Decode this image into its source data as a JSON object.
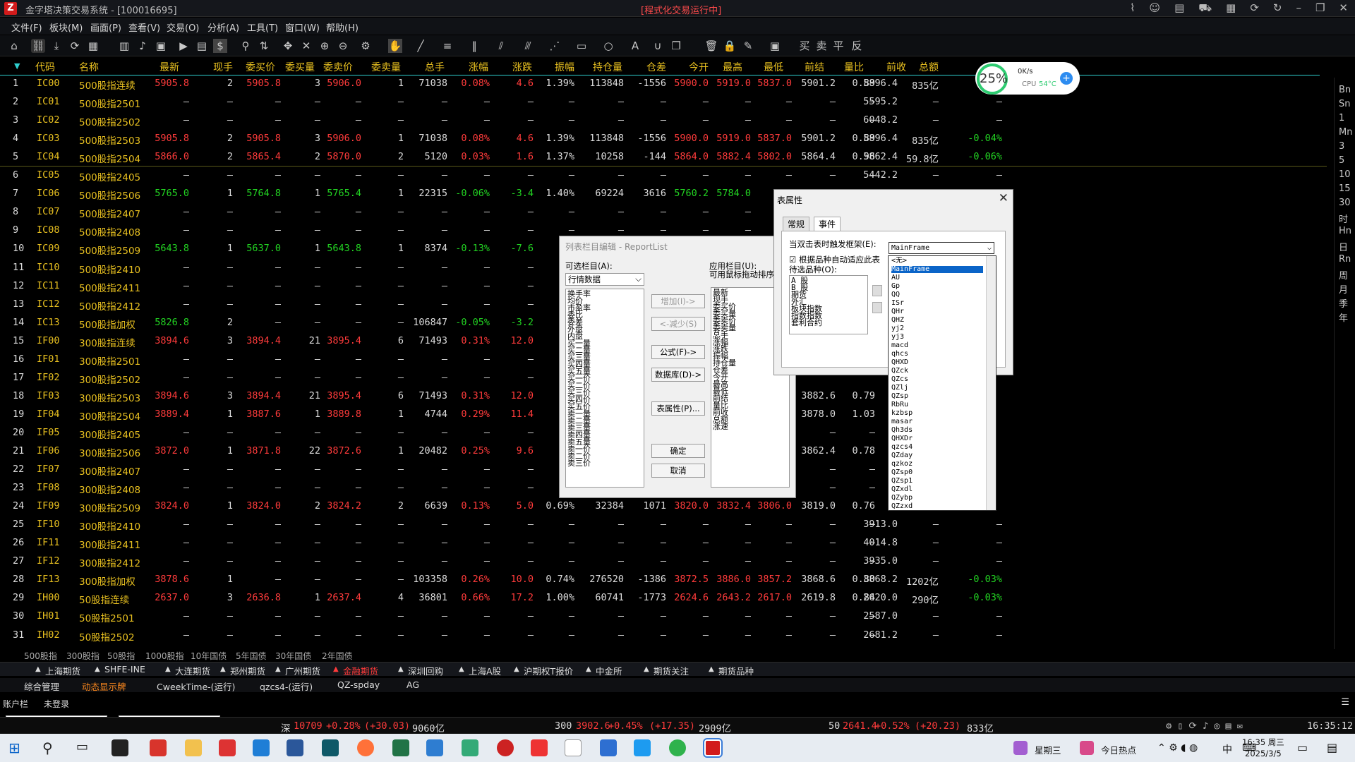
{
  "app": {
    "title": "金字塔决策交易系统 - [100016695]",
    "center_status": "[程式化交易运行中]"
  },
  "menu": [
    "文件(F)",
    "板块(M)",
    "画面(P)",
    "查看(V)",
    "交易(O)",
    "分析(A)",
    "工具(T)",
    "窗口(W)",
    "帮助(H)"
  ],
  "columns": [
    "代码",
    "名称",
    "最新",
    "现手",
    "委买价",
    "委买量",
    "委卖价",
    "委卖量",
    "总手",
    "涨幅",
    "涨跌",
    "振幅",
    "持仓量",
    "仓差",
    "今开",
    "最高",
    "最低",
    "前结",
    "量比",
    "前收",
    "总额"
  ],
  "colors": {
    "header": "#e8c020",
    "up": "#ff3b3b",
    "down": "#22d322",
    "neutral": "#dddddd",
    "code": "#e8c020",
    "name": "#e8c020"
  },
  "rows": [
    [
      "1",
      "IC00",
      "500股指连续",
      "5905.8",
      "2",
      "5905.8",
      "3",
      "5906.0",
      "1",
      "71038",
      "0.08%",
      "4.6",
      "1.39%",
      "113848",
      "-1556",
      "5900.0",
      "5919.0",
      "5837.0",
      "5901.2",
      "0.89",
      "5896.4",
      "835亿",
      ""
    ],
    [
      "2",
      "IC01",
      "500股指2501",
      "—",
      "—",
      "—",
      "—",
      "—",
      "—",
      "—",
      "—",
      "—",
      "—",
      "—",
      "—",
      "—",
      "—",
      "—",
      "—",
      "—",
      "5595.2",
      "—",
      "—"
    ],
    [
      "3",
      "IC02",
      "500股指2502",
      "—",
      "—",
      "—",
      "—",
      "—",
      "—",
      "—",
      "—",
      "—",
      "—",
      "—",
      "—",
      "—",
      "—",
      "—",
      "—",
      "—",
      "6048.2",
      "—",
      "—"
    ],
    [
      "4",
      "IC03",
      "500股指2503",
      "5905.8",
      "2",
      "5905.8",
      "3",
      "5906.0",
      "1",
      "71038",
      "0.08%",
      "4.6",
      "1.39%",
      "113848",
      "-1556",
      "5900.0",
      "5919.0",
      "5837.0",
      "5901.2",
      "0.89",
      "5896.4",
      "835亿",
      "-0.04%"
    ],
    [
      "5",
      "IC04",
      "500股指2504",
      "5866.0",
      "2",
      "5865.4",
      "2",
      "5870.0",
      "2",
      "5120",
      "0.03%",
      "1.6",
      "1.37%",
      "10258",
      "-144",
      "5864.0",
      "5882.4",
      "5802.0",
      "5864.4",
      "0.96",
      "5862.4",
      "59.8亿",
      "-0.06%"
    ],
    [
      "6",
      "IC05",
      "500股指2405",
      "—",
      "—",
      "—",
      "—",
      "—",
      "—",
      "—",
      "—",
      "—",
      "—",
      "—",
      "—",
      "—",
      "—",
      "—",
      "—",
      "—",
      "5442.2",
      "—",
      "—"
    ],
    [
      "7",
      "IC06",
      "500股指2506",
      "5765.0",
      "1",
      "5764.8",
      "1",
      "5765.4",
      "1",
      "22315",
      "-0.06%",
      "-3.4",
      "1.40%",
      "69224",
      "3616",
      "5760.2",
      "5784.0",
      "57",
      "",
      "",
      "",
      "",
      ""
    ],
    [
      "8",
      "IC07",
      "500股指2407",
      "—",
      "—",
      "—",
      "—",
      "—",
      "—",
      "—",
      "—",
      "—",
      "—",
      "—",
      "—",
      "—",
      "—",
      "",
      "",
      "",
      "",
      "",
      ""
    ],
    [
      "9",
      "IC08",
      "500股指2408",
      "—",
      "—",
      "—",
      "—",
      "—",
      "—",
      "—",
      "—",
      "—",
      "—",
      "—",
      "—",
      "—",
      "—",
      "",
      "",
      "",
      "",
      "",
      ""
    ],
    [
      "10",
      "IC09",
      "500股指2509",
      "5643.8",
      "1",
      "5637.0",
      "1",
      "5643.8",
      "1",
      "8374",
      "-0.13%",
      "-7.6",
      "1.",
      "",
      "",
      "",
      "",
      "",
      "",
      "",
      "",
      "",
      ""
    ],
    [
      "11",
      "IC10",
      "500股指2410",
      "—",
      "—",
      "—",
      "—",
      "—",
      "—",
      "—",
      "—",
      "—",
      "",
      "",
      "",
      "",
      "",
      "",
      "",
      "",
      "",
      "",
      ""
    ],
    [
      "12",
      "IC11",
      "500股指2411",
      "—",
      "—",
      "—",
      "—",
      "—",
      "—",
      "—",
      "—",
      "—",
      "",
      "",
      "",
      "",
      "",
      "",
      "",
      "",
      "",
      "",
      ""
    ],
    [
      "13",
      "IC12",
      "500股指2412",
      "—",
      "—",
      "—",
      "—",
      "—",
      "—",
      "—",
      "—",
      "—",
      "",
      "",
      "",
      "",
      "",
      "",
      "",
      "",
      "",
      "",
      ""
    ],
    [
      "14",
      "IC13",
      "500股指加权",
      "5826.8",
      "2",
      "—",
      "—",
      "—",
      "—",
      "106847",
      "-0.05%",
      "-3.2",
      "1.",
      "",
      "",
      "",
      "",
      "",
      "",
      "",
      "",
      "",
      ""
    ],
    [
      "15",
      "IF00",
      "300股指连续",
      "3894.6",
      "3",
      "3894.4",
      "21",
      "3895.4",
      "6",
      "71493",
      "0.31%",
      "12.0",
      "0.",
      "",
      "",
      "",
      "",
      "",
      "",
      "",
      "",
      "",
      ""
    ],
    [
      "16",
      "IF01",
      "300股指2501",
      "—",
      "—",
      "—",
      "—",
      "—",
      "—",
      "—",
      "—",
      "—",
      "",
      "",
      "",
      "",
      "",
      "",
      "",
      "",
      "",
      "",
      ""
    ],
    [
      "17",
      "IF02",
      "300股指2502",
      "—",
      "—",
      "—",
      "—",
      "—",
      "—",
      "—",
      "—",
      "—",
      "",
      "",
      "",
      "",
      "",
      "",
      "",
      "",
      "",
      "",
      ""
    ],
    [
      "18",
      "IF03",
      "300股指2503",
      "3894.6",
      "3",
      "3894.4",
      "21",
      "3895.4",
      "6",
      "71493",
      "0.31%",
      "12.0",
      "0.",
      "",
      "",
      "",
      "",
      "",
      "3882.6",
      "0.79",
      "",
      "",
      ""
    ],
    [
      "19",
      "IF04",
      "300股指2504",
      "3889.4",
      "1",
      "3887.6",
      "1",
      "3889.8",
      "1",
      "4744",
      "0.29%",
      "11.4",
      "0.",
      "",
      "",
      "",
      "",
      "",
      "3878.0",
      "1.03",
      "",
      "",
      ""
    ],
    [
      "20",
      "IF05",
      "300股指2405",
      "—",
      "—",
      "—",
      "—",
      "—",
      "—",
      "—",
      "—",
      "—",
      "",
      "",
      "",
      "",
      "",
      "",
      "—",
      "—",
      "",
      "",
      ""
    ],
    [
      "21",
      "IF06",
      "300股指2506",
      "3872.0",
      "1",
      "3871.8",
      "22",
      "3872.6",
      "1",
      "20482",
      "0.25%",
      "9.6",
      "0.",
      "",
      "",
      "",
      "",
      "",
      "3862.4",
      "0.78",
      "",
      "",
      ""
    ],
    [
      "22",
      "IF07",
      "300股指2407",
      "—",
      "—",
      "—",
      "—",
      "—",
      "—",
      "—",
      "—",
      "—",
      "",
      "",
      "",
      "",
      "",
      "",
      "—",
      "—",
      "",
      "",
      ""
    ],
    [
      "23",
      "IF08",
      "300股指2408",
      "—",
      "—",
      "—",
      "—",
      "—",
      "—",
      "—",
      "—",
      "—",
      "",
      "",
      "",
      "",
      "",
      "",
      "—",
      "—",
      "",
      "",
      ""
    ],
    [
      "24",
      "IF09",
      "300股指2509",
      "3824.0",
      "1",
      "3824.0",
      "2",
      "3824.2",
      "2",
      "6639",
      "0.13%",
      "5.0",
      "0.69%",
      "32384",
      "1071",
      "3820.0",
      "3832.4",
      "3806.0",
      "3819.0",
      "0.76",
      "",
      "",
      ""
    ],
    [
      "25",
      "IF10",
      "300股指2410",
      "—",
      "—",
      "—",
      "—",
      "—",
      "—",
      "—",
      "—",
      "—",
      "—",
      "—",
      "—",
      "—",
      "—",
      "—",
      "—",
      "—",
      "3913.0",
      "—",
      "—"
    ],
    [
      "26",
      "IF11",
      "300股指2411",
      "—",
      "—",
      "—",
      "—",
      "—",
      "—",
      "—",
      "—",
      "—",
      "—",
      "—",
      "—",
      "—",
      "—",
      "—",
      "—",
      "—",
      "4014.8",
      "—",
      "—"
    ],
    [
      "27",
      "IF12",
      "300股指2412",
      "—",
      "—",
      "—",
      "—",
      "—",
      "—",
      "—",
      "—",
      "—",
      "—",
      "—",
      "—",
      "—",
      "—",
      "—",
      "—",
      "—",
      "3935.0",
      "—",
      "—"
    ],
    [
      "28",
      "IF13",
      "300股指加权",
      "3878.6",
      "1",
      "—",
      "—",
      "—",
      "—",
      "103358",
      "0.26%",
      "10.0",
      "0.74%",
      "276520",
      "-1386",
      "3872.5",
      "3886.0",
      "3857.2",
      "3868.6",
      "0.80",
      "3868.2",
      "1202亿",
      "-0.03%"
    ],
    [
      "29",
      "IH00",
      "50股指连续",
      "2637.0",
      "3",
      "2636.8",
      "1",
      "2637.4",
      "4",
      "36801",
      "0.66%",
      "17.2",
      "1.00%",
      "60741",
      "-1773",
      "2624.6",
      "2643.2",
      "2617.0",
      "2619.8",
      "0.84",
      "2620.0",
      "290亿",
      "-0.03%"
    ],
    [
      "30",
      "IH01",
      "50股指2501",
      "—",
      "—",
      "—",
      "—",
      "—",
      "—",
      "—",
      "—",
      "—",
      "—",
      "—",
      "—",
      "—",
      "—",
      "—",
      "—",
      "—",
      "2587.0",
      "—",
      "—"
    ],
    [
      "31",
      "IH02",
      "50股指2502",
      "—",
      "—",
      "—",
      "—",
      "—",
      "—",
      "—",
      "—",
      "—",
      "—",
      "—",
      "—",
      "—",
      "—",
      "—",
      "—",
      "—",
      "2681.2",
      "—",
      "—"
    ]
  ],
  "rightbar": [
    "Bn",
    "Sn",
    "1",
    "Mn",
    "3",
    "5",
    "10",
    "15",
    "30",
    "时",
    "Hn",
    "日",
    "Rn",
    "周",
    "月",
    "季",
    "年"
  ],
  "cpu": {
    "percent": "25%",
    "speed": "0K/s",
    "cpu_label": "CPU",
    "temp": "54°C"
  },
  "dialog_report": {
    "title": "列表栏目编辑 - ReportList",
    "avail_label": "可选栏目(A):",
    "avail_select": "行情数据",
    "applied_label": "应用栏目(U):",
    "applied_hint": "可用鼠标拖动排序",
    "add": "增加(I)->",
    "remove": "<-减少(S)",
    "formula": "公式(F)->",
    "database": "数据库(D)->",
    "props": "表属性(P)...",
    "ok": "确定",
    "cancel": "取消",
    "avail_items": [
      "换手率",
      "均价",
      "市盈率",
      "委比",
      "委差",
      "外盘",
      "内盘",
      "买一量",
      "买二量",
      "买三量",
      "买四量",
      "买五量",
      "买一价",
      "买二价",
      "买三价",
      "买四价",
      "买五价",
      "卖一量",
      "卖二量",
      "卖三量",
      "卖四量",
      "卖五量",
      "卖一价",
      "卖二价",
      "卖三价"
    ],
    "applied_items": [
      "最新",
      "现手",
      "委买价",
      "委买量",
      "委卖价",
      "委卖量",
      "总手",
      "涨幅",
      "涨跌",
      "振幅",
      "持仓量",
      "仓差",
      "今开",
      "最高",
      "最低",
      "前结",
      "量比",
      "前收",
      "总额",
      "涨速"
    ]
  },
  "dialog_props": {
    "title": "表属性",
    "tab_general": "常规",
    "tab_event": "事件",
    "trigger_label": "当双击表时触发框架(E):",
    "trigger_value": "MainFrame",
    "checkbox_label": "根据品种自动适应此表",
    "pending_label": "待选品种(O):",
    "pending_items": [
      "A 股",
      "B 股",
      "期货",
      "外汇",
      "板块指数",
      "指数指数",
      "套利合约"
    ]
  },
  "droplist": [
    "<无>",
    "MainFrame",
    "AU",
    "Gp",
    "QQ",
    "ISr",
    "QHr",
    "QHZ",
    "yj2",
    "yj3",
    "macd",
    "qhcs",
    "QHXD",
    "QZck",
    "QZcs",
    "QZlj",
    "QZsp",
    "RbRu",
    "kzbsp",
    "masar",
    "Qh3ds",
    "QHXDr",
    "qzcs4",
    "QZday",
    "qzkoz",
    "QZsp0",
    "QZsp1",
    "QZxdl",
    "QZybp",
    "QZzxd"
  ],
  "sheet_tabs": [
    "500股指",
    "300股指",
    "50股指",
    "1000股指",
    "10年国债",
    "5年国债",
    "30年国债",
    "2年国债"
  ],
  "market_tabs": [
    "上海期货",
    "SHFE-INE",
    "大连期货",
    "郑州期货",
    "广州期货",
    "金融期货",
    "深圳回购",
    "上海A股",
    "沪期权T报价",
    "中金所",
    "期货关注",
    "期货品种"
  ],
  "active_market": "金融期货",
  "workspaces": [
    "综合管理",
    "动态显示牌",
    "CweekTime-(运行)",
    "qzcs4-(运行)",
    "QZ-spday",
    "AG"
  ],
  "account": {
    "label": "账户栏",
    "status": "未登录"
  },
  "status": {
    "s1_name": "深",
    "s1_val": "10709",
    "s1_chg": "+0.28%",
    "s1_pts": "(+30.03)",
    "s1_amt": "9060亿",
    "s2_name": "300",
    "s2_val": "3902.6",
    "s2_chg": "+0.45%",
    "s2_pts": "(+17.35)",
    "s2_amt": "2909亿",
    "s3_name": "50",
    "s3_val": "2641.4",
    "s3_chg": "+0.52%",
    "s3_pts": "(+20.23)",
    "s3_amt": "833亿",
    "time": "16:35:12"
  },
  "taskbar": {
    "weekday_label": "星期三",
    "news": "今日热点",
    "ime": "中",
    "clock": "16:35 周三",
    "date": "2025/3/5"
  }
}
